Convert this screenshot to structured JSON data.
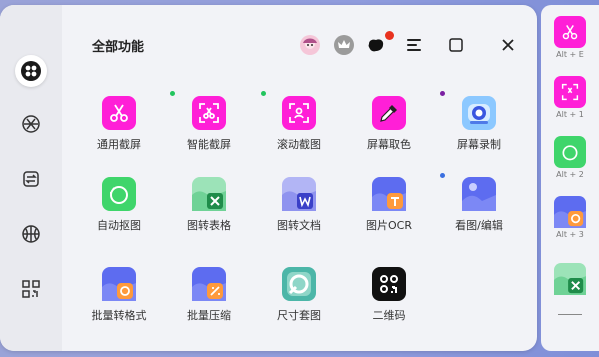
{
  "window": {
    "title": "全部功能"
  },
  "header_icons": [
    "avatar-icon",
    "crown-icon",
    "skin-icon",
    "menu-icon",
    "maximize-icon",
    "close-icon"
  ],
  "rail": {
    "items": [
      "all-features-icon",
      "aperture-icon",
      "convert-icon",
      "basketball-icon",
      "qr-scan-icon"
    ]
  },
  "tools": [
    {
      "label": "通用截屏",
      "icon": "scissors-icon",
      "color": "#ff1fd7"
    },
    {
      "label": "智能截屏",
      "icon": "smart-screenshot-icon",
      "color": "#ff1fd7"
    },
    {
      "label": "滚动截图",
      "icon": "scroll-screenshot-icon",
      "color": "#ff1fd7"
    },
    {
      "label": "屏幕取色",
      "icon": "eyedropper-icon",
      "color": "#ff1fd7"
    },
    {
      "label": "屏幕录制",
      "icon": "camera-icon",
      "color": "#6fb8ff"
    },
    {
      "label": "自动抠图",
      "icon": "cutout-icon",
      "color": "#3fd56b"
    },
    {
      "label": "图转表格",
      "icon": "image-to-excel-icon",
      "color": "#6ad89a"
    },
    {
      "label": "图转文档",
      "icon": "image-to-word-icon",
      "color": "#8a8cf0"
    },
    {
      "label": "图片OCR",
      "icon": "ocr-icon",
      "color": "#5d6cf0"
    },
    {
      "label": "看图/编辑",
      "icon": "image-viewer-icon",
      "color": "#5d6cf0"
    },
    {
      "label": "批量转格式",
      "icon": "batch-convert-icon",
      "color": "#5d6cf0"
    },
    {
      "label": "批量压缩",
      "icon": "batch-compress-icon",
      "color": "#5d6cf0"
    },
    {
      "label": "尺寸套图",
      "icon": "size-template-icon",
      "color": "#4cb6a8"
    },
    {
      "label": "二维码",
      "icon": "qrcode-icon",
      "color": "#111111"
    }
  ],
  "badges": {
    "green": "#22c55e",
    "purple": "#7b1fa2",
    "blue": "#3b6fe0",
    "red": "#e8321f"
  },
  "side_shortcuts": [
    {
      "icon": "scissors-icon",
      "key": "Alt + E"
    },
    {
      "icon": "smart-screenshot-icon",
      "key": "Alt + 1"
    },
    {
      "icon": "cutout-icon",
      "key": "Alt + 2"
    },
    {
      "icon": "batch-convert-icon",
      "key": "Alt + 3"
    },
    {
      "icon": "image-to-excel-icon",
      "key": ""
    }
  ]
}
